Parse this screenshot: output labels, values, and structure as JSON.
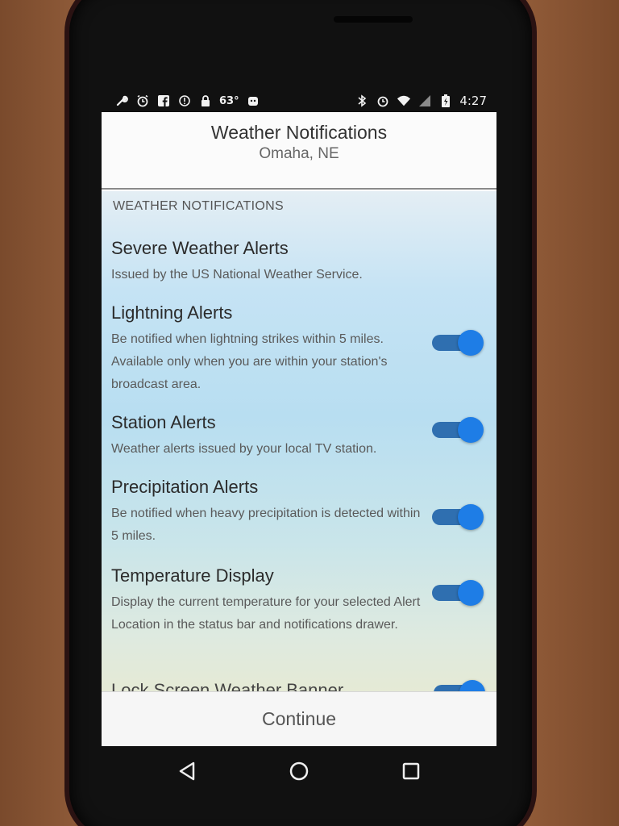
{
  "status_bar": {
    "left_icons": [
      "wrench-icon",
      "alarm-icon",
      "facebook-icon",
      "info-icon",
      "lock-icon"
    ],
    "temperature": "63°",
    "right_icons": [
      "bluetooth-icon",
      "alarm-icon",
      "wifi-icon",
      "signal-icon",
      "battery-icon"
    ],
    "time": "4:27"
  },
  "header": {
    "title": "Weather Notifications",
    "subtitle": "Omaha, NE"
  },
  "section": {
    "header": "WEATHER NOTIFICATIONS"
  },
  "items": [
    {
      "title": "Severe Weather Alerts",
      "description": "Issued by the US National Weather Service.",
      "enabled": true
    },
    {
      "title": "Lightning Alerts",
      "description": "Be notified when lightning strikes within 5 miles. Available only when you are within your station's broadcast area.",
      "enabled": true
    },
    {
      "title": "Station Alerts",
      "description": "Weather alerts issued by your local TV station.",
      "enabled": true
    },
    {
      "title": "Precipitation Alerts",
      "description": "Be notified when heavy precipitation is detected within 5 miles.",
      "enabled": true
    },
    {
      "title": "Temperature Display",
      "description": "Display the current temperature for your selected Alert Location in the status bar and notifications drawer.",
      "enabled": true
    }
  ],
  "partial_item": {
    "title": "Lock Screen Weather Banner",
    "enabled": true
  },
  "footer": {
    "continue_label": "Continue"
  },
  "colors": {
    "toggle_track": "#2f6fb0",
    "toggle_thumb": "#1e7de6"
  }
}
